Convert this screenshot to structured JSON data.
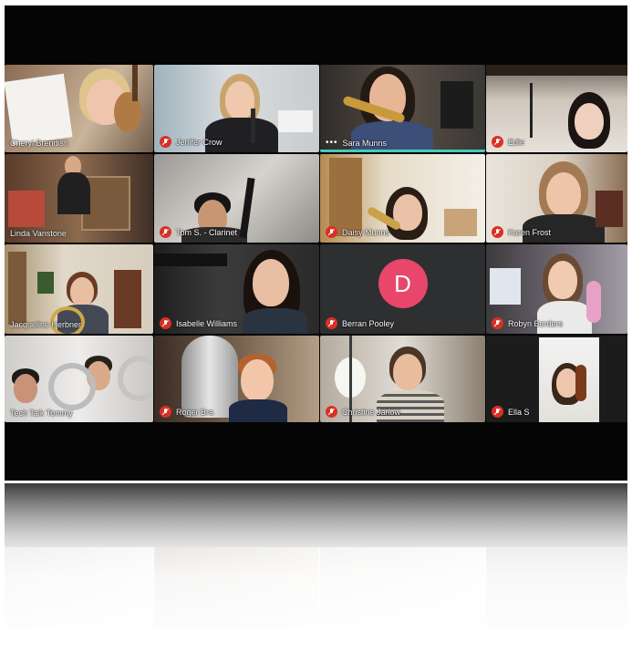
{
  "meeting": {
    "participants": [
      {
        "name": "Cheryl Brendish",
        "muted": true
      },
      {
        "name": "Jenifer Crow",
        "muted": true
      },
      {
        "name": "Sara Munns",
        "muted": false,
        "speaking": true,
        "indicator": "•••"
      },
      {
        "name": "Edie",
        "muted": true
      },
      {
        "name": "Linda Vanstone",
        "muted": false
      },
      {
        "name": "Tom S. - Clarinet",
        "muted": true
      },
      {
        "name": "Daisy Munns",
        "muted": true
      },
      {
        "name": "Karen Frost",
        "muted": true
      },
      {
        "name": "Jacqueline Herbner",
        "muted": false
      },
      {
        "name": "Isabelle Williams",
        "muted": true
      },
      {
        "name": "Berran Pooley",
        "muted": true,
        "avatar_initial": "D",
        "avatar_color": "#e8466b"
      },
      {
        "name": "Robyn Borders",
        "muted": true
      },
      {
        "name": "Tech Talk Tommy",
        "muted": false
      },
      {
        "name": "Roger Bra",
        "muted": true
      },
      {
        "name": "Christine Jarlow",
        "muted": true
      },
      {
        "name": "Ella S",
        "muted": true
      }
    ]
  },
  "colors": {
    "speaking_border": "#49c9b8",
    "mic_off": "#d93025",
    "background": "#050505"
  }
}
